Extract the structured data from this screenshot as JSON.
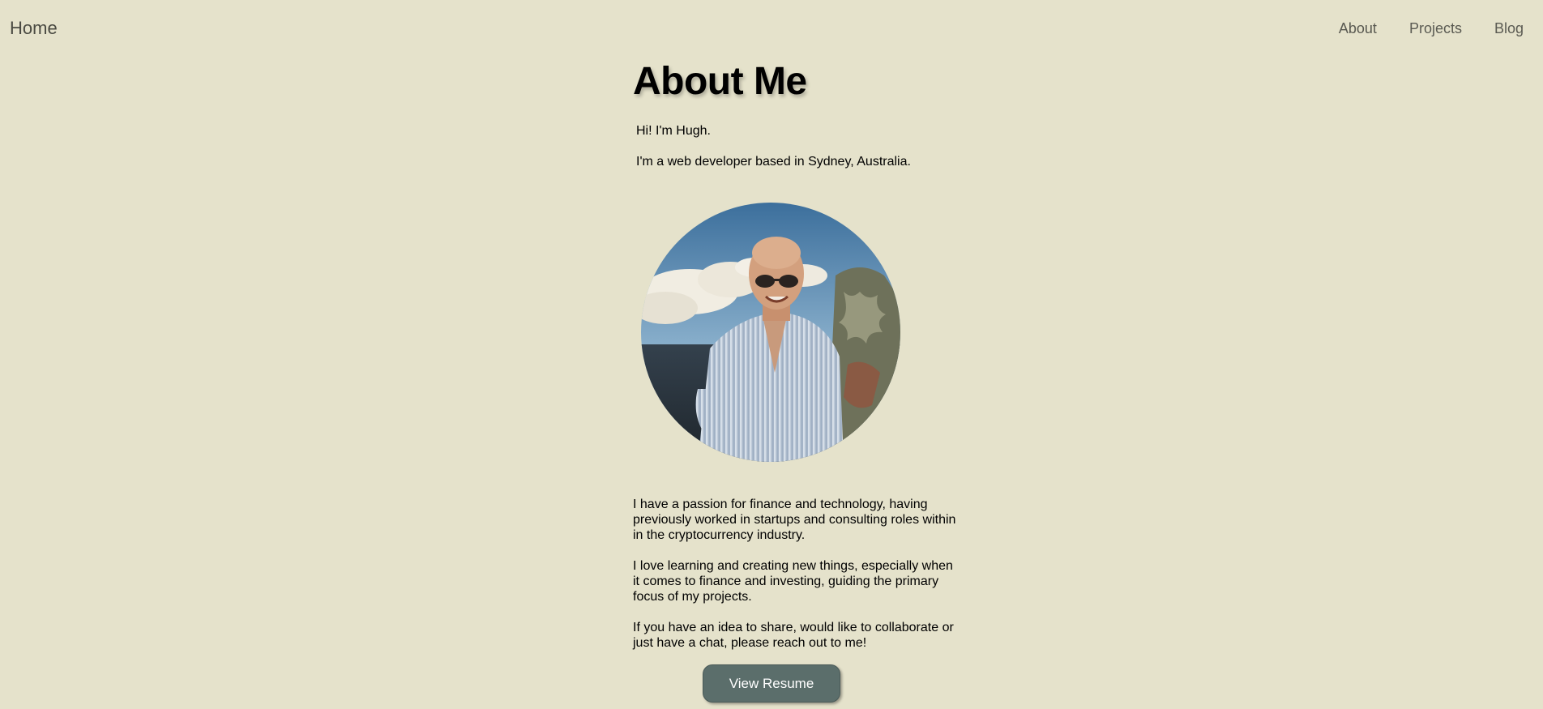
{
  "nav": {
    "home_label": "Home",
    "links": [
      "About",
      "Projects",
      "Blog"
    ]
  },
  "about": {
    "title": "About Me",
    "intro": [
      "Hi! I'm Hugh.",
      "I'm a web developer based in Sydney, Australia."
    ],
    "bio": [
      "I have a passion for finance and technology, having previously worked in startups and consulting roles within in the cryptocurrency industry.",
      "I love learning and creating new things, especially when it comes to finance and investing, guiding the primary focus of my projects.",
      "If you have an idea to share, would like to collaborate or just have a chat, please reach out to me!"
    ],
    "resume_button_label": "View Resume"
  },
  "colors": {
    "background": "#e5e2cb",
    "button": "#5b6e6b",
    "nav_text": "#5a5a52"
  }
}
